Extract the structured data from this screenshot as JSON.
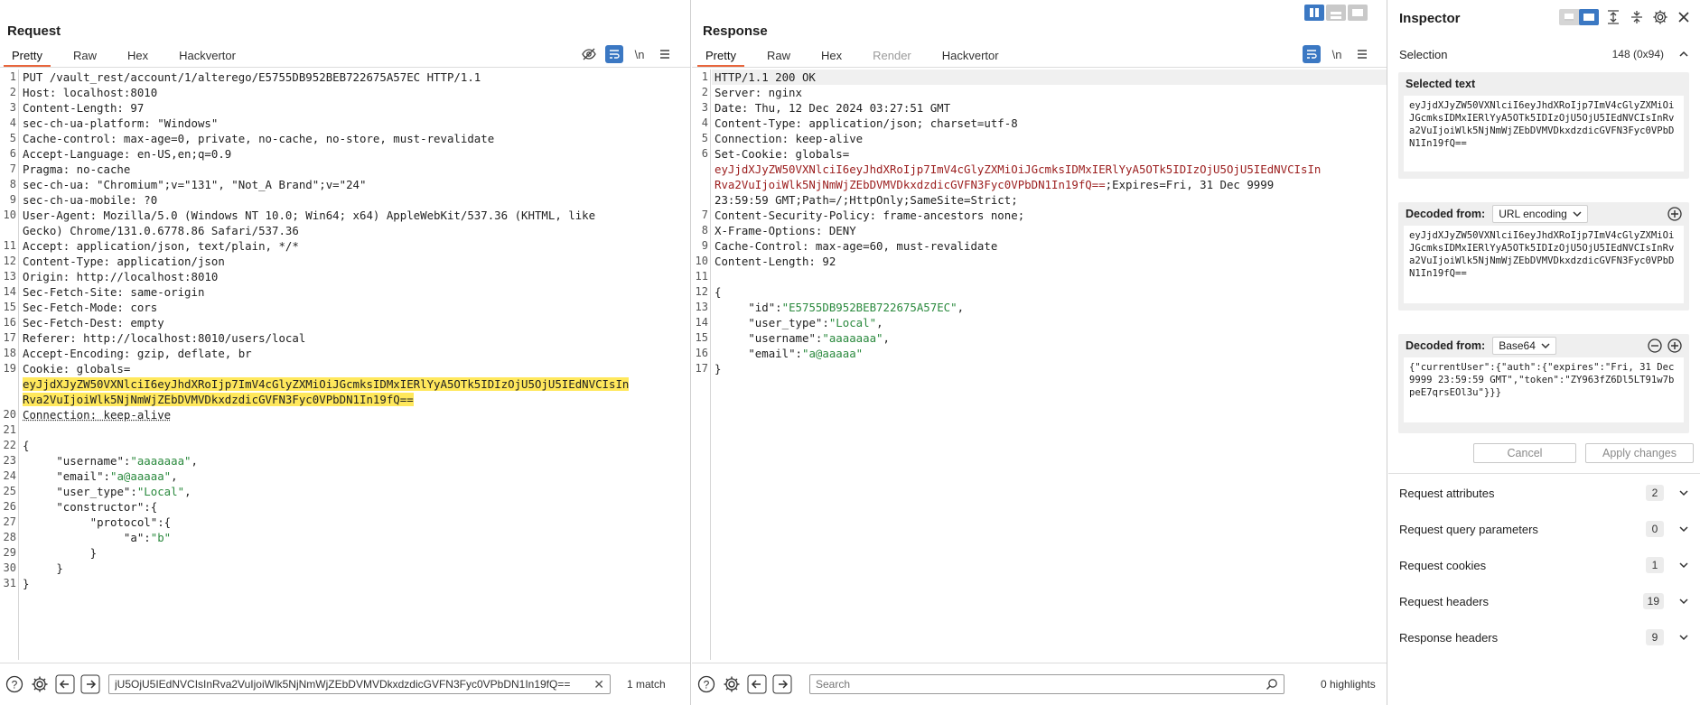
{
  "request": {
    "title": "Request",
    "tabs": [
      "Pretty",
      "Raw",
      "Hex",
      "Hackvertor"
    ],
    "active_tab": "Pretty",
    "newline_toggle": "\\n",
    "lines": [
      {
        "n": "1",
        "t": "PUT /vault_rest/account/1/alterego/E5755DB952BEB722675A57EC HTTP/1.1"
      },
      {
        "n": "2",
        "t": "Host: localhost:8010"
      },
      {
        "n": "3",
        "t": "Content-Length: 97"
      },
      {
        "n": "4",
        "t": "sec-ch-ua-platform: \"Windows\""
      },
      {
        "n": "5",
        "t": "Cache-control: max-age=0, private, no-cache, no-store, must-revalidate"
      },
      {
        "n": "6",
        "t": "Accept-Language: en-US,en;q=0.9"
      },
      {
        "n": "7",
        "t": "Pragma: no-cache"
      },
      {
        "n": "8",
        "t": "sec-ch-ua: \"Chromium\";v=\"131\", \"Not_A Brand\";v=\"24\""
      },
      {
        "n": "9",
        "t": "sec-ch-ua-mobile: ?0"
      },
      {
        "n": "10",
        "t": "User-Agent: Mozilla/5.0 (Windows NT 10.0; Win64; x64) AppleWebKit/537.36 (KHTML, like"
      },
      {
        "n": "",
        "t": "Gecko) Chrome/131.0.6778.86 Safari/537.36"
      },
      {
        "n": "11",
        "t": "Accept: application/json, text/plain, */*"
      },
      {
        "n": "12",
        "t": "Content-Type: application/json"
      },
      {
        "n": "13",
        "t": "Origin: http://localhost:8010"
      },
      {
        "n": "14",
        "t": "Sec-Fetch-Site: same-origin"
      },
      {
        "n": "15",
        "t": "Sec-Fetch-Mode: cors"
      },
      {
        "n": "16",
        "t": "Sec-Fetch-Dest: empty"
      },
      {
        "n": "17",
        "t": "Referer: http://localhost:8010/users/local"
      },
      {
        "n": "18",
        "t": "Accept-Encoding: gzip, deflate, br"
      },
      {
        "n": "19",
        "t": "Cookie: globals="
      }
    ],
    "cookie_value_1": "eyJjdXJyZW50VXNlciI6eyJhdXRoIjp7ImV4cGlyZXMiOiJGcmksIDMxIERlYyA5OTk5IDIzOjU5OjU5IEdNVCIsIn",
    "cookie_value_2": "Rva2VuIjoiWlk5NjNmWjZEbDVMVDkxdzdicGVFN3Fyc0VPbDN1In19fQ==",
    "lines_after": [
      {
        "n": "20",
        "t": "Connection: keep-alive"
      },
      {
        "n": "21",
        "t": ""
      },
      {
        "n": "22",
        "t": "{"
      }
    ],
    "body": [
      {
        "indent": 1,
        "key": "\"username\"",
        "val": "\"aaaaaaa\"",
        "end": ","
      },
      {
        "indent": 1,
        "key": "\"email\"",
        "val": "\"a@aaaaa\"",
        "end": ","
      },
      {
        "indent": 1,
        "key": "\"user_type\"",
        "val": "\"Local\"",
        "end": ","
      },
      {
        "indent": 1,
        "key": "\"constructor\"",
        "val": "",
        "end": "{"
      },
      {
        "indent": 2,
        "key": "\"protocol\"",
        "val": "",
        "end": "{"
      },
      {
        "indent": 3,
        "key": "\"a\"",
        "val": "\"b\"",
        "end": ""
      },
      {
        "indent": 2,
        "key": "",
        "val": "",
        "end": "}"
      },
      {
        "indent": 1,
        "key": "",
        "val": "",
        "end": "}"
      },
      {
        "indent": 0,
        "key": "",
        "val": "",
        "end": "}"
      }
    ],
    "search_value": "jU5OjU5IEdNVCIsInRva2VuIjoiWlk5NjNmWjZEbDVMVDkxdzdicGVFN3Fyc0VPbDN1In19fQ==",
    "match_text": "1 match"
  },
  "response": {
    "title": "Response",
    "tabs": [
      "Pretty",
      "Raw",
      "Hex",
      "Render",
      "Hackvertor"
    ],
    "active_tab": "Pretty",
    "newline_toggle": "\\n",
    "lines": [
      {
        "n": "1",
        "t": "HTTP/1.1 200 OK"
      },
      {
        "n": "2",
        "t": "Server: nginx"
      },
      {
        "n": "3",
        "t": "Date: Thu, 12 Dec 2024 03:27:51 GMT"
      },
      {
        "n": "4",
        "t": "Content-Type: application/json; charset=utf-8"
      },
      {
        "n": "5",
        "t": "Connection: keep-alive"
      },
      {
        "n": "6",
        "t": "Set-Cookie: globals="
      }
    ],
    "setcookie_1": "eyJjdXJyZW50VXNlciI6eyJhdXRoIjp7ImV4cGlyZXMiOiJGcmksIDMxIERlYyA5OTk5IDIzOjU5OjU5IEdNVCIsIn",
    "setcookie_2": "Rva2VuIjoiWlk5NjNmWjZEbDVMVDkxdzdicGVFN3Fyc0VPbDN1In19fQ==",
    "setcookie_2_tail": ";Expires=Fri, 31 Dec 9999",
    "setcookie_3": "23:59:59 GMT;Path=/;HttpOnly;SameSite=Strict;",
    "lines_after": [
      {
        "n": "7",
        "t": "Content-Security-Policy: frame-ancestors none;"
      },
      {
        "n": "8",
        "t": "X-Frame-Options: DENY"
      },
      {
        "n": "9",
        "t": "Cache-Control: max-age=60, must-revalidate"
      },
      {
        "n": "10",
        "t": "Content-Length: 92"
      },
      {
        "n": "11",
        "t": ""
      },
      {
        "n": "12",
        "t": "{"
      }
    ],
    "body": [
      {
        "key": "\"id\"",
        "val": "\"E5755DB952BEB722675A57EC\"",
        "end": ","
      },
      {
        "key": "\"user_type\"",
        "val": "\"Local\"",
        "end": ","
      },
      {
        "key": "\"username\"",
        "val": "\"aaaaaaa\"",
        "end": ","
      },
      {
        "key": "\"email\"",
        "val": "\"a@aaaaa\"",
        "end": ""
      }
    ],
    "close": "}",
    "search_placeholder": "Search",
    "highlights_text": "0 highlights"
  },
  "inspector": {
    "title": "Inspector",
    "selection_label": "Selection",
    "selection_value": "148 (0x94)",
    "selected_text_label": "Selected text",
    "selected_text": "eyJjdXJyZW50VXNlciI6eyJhdXRoIjp7ImV4cGlyZXMiOiJGcmksIDMxIERlYyA5OTk5IDIzOjU5OjU5IEdNVCIsInRva2VuIjoiWlk5NjNmWjZEbDVMVDkxdzdicGVFN3Fyc0VPbDN1In19fQ==",
    "decoded1_label": "Decoded from:",
    "decoded1_type": "URL encoding",
    "decoded1_text": "eyJjdXJyZW50VXNlciI6eyJhdXRoIjp7ImV4cGlyZXMiOiJGcmksIDMxIERlYyA5OTk5IDIzOjU5OjU5IEdNVCIsInRva2VuIjoiWlk5NjNmWjZEbDVMVDkxdzdicGVFN3Fyc0VPbDN1In19fQ==",
    "decoded2_label": "Decoded from:",
    "decoded2_type": "Base64",
    "decoded2_text": "{\"currentUser\":{\"auth\":{\"expires\":\"Fri, 31 Dec 9999 23:59:59 GMT\",\"token\":\"ZY963fZ6Dl5LT91w7bpeE7qrsEOl3u\"}}}",
    "cancel_label": "Cancel",
    "apply_label": "Apply changes",
    "sections": [
      {
        "name": "Request attributes",
        "count": "2"
      },
      {
        "name": "Request query parameters",
        "count": "0"
      },
      {
        "name": "Request cookies",
        "count": "1"
      },
      {
        "name": "Request headers",
        "count": "19"
      },
      {
        "name": "Response headers",
        "count": "9"
      }
    ]
  },
  "colors": {
    "accent": "#3b78c3",
    "highlight": "#ffe85c",
    "tab_underline": "#e8663d",
    "json_value": "#2b8a3e",
    "cookie_value": "#9b1d1d"
  }
}
